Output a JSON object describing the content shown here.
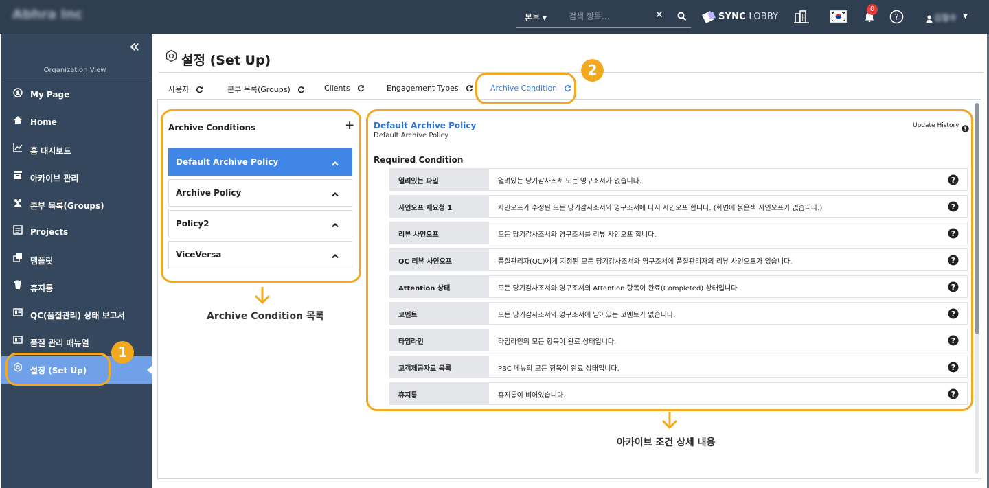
{
  "topbar": {
    "brand": "Abhra Inc",
    "scope_label": "본부 ▾",
    "search_placeholder": "검색 항목...",
    "clear_symbol": "✕",
    "sync_bold": "SYNC",
    "sync_light": "LOBBY",
    "notification_count": "0",
    "user_name": "김철수"
  },
  "sidebar": {
    "collapse_symbol": "«",
    "org_view_label": "Organization View",
    "items": [
      {
        "label": "My Page",
        "icon": "user-circle-icon"
      },
      {
        "label": "Home",
        "icon": "home-icon"
      },
      {
        "label": "홈 대시보드",
        "icon": "line-chart-icon"
      },
      {
        "label": "아카이브 관리",
        "icon": "archive-box-icon"
      },
      {
        "label": "본부 목록(Groups)",
        "icon": "users-icon"
      },
      {
        "label": "Projects",
        "icon": "projects-icon"
      },
      {
        "label": "템플릿",
        "icon": "template-icon"
      },
      {
        "label": "휴지통",
        "icon": "trash-icon"
      },
      {
        "label": "QC(품질관리) 상태 보고서",
        "icon": "report-icon"
      },
      {
        "label": "품질 관리 매뉴얼",
        "icon": "manual-icon"
      },
      {
        "label": "설정 (Set Up)",
        "icon": "settings-icon",
        "active": true
      }
    ]
  },
  "page": {
    "title": "설정 (Set Up)",
    "tabs": [
      {
        "label": "사용자"
      },
      {
        "label": "본부 목록(Groups)"
      },
      {
        "label": "Clients"
      },
      {
        "label": "Engagement Types"
      },
      {
        "label": "Archive Condition",
        "active": true
      }
    ]
  },
  "archive_list": {
    "title": "Archive Conditions",
    "add_symbol": "+",
    "policies": [
      {
        "label": "Default Archive Policy",
        "selected": true
      },
      {
        "label": "Archive Policy"
      },
      {
        "label": "Policy2"
      },
      {
        "label": "ViceVersa"
      }
    ]
  },
  "detail": {
    "title": "Default Archive Policy",
    "subtitle": "Default Archive Policy",
    "update_history": "Update History",
    "required_title": "Required Condition",
    "conditions": [
      {
        "name": "열려있는 파일",
        "desc": "열려있는 당기감사조서 또는 영구조서가 없습니다."
      },
      {
        "name": "사인오프 재요청 1",
        "desc": "사인오프가 수정된 모든 당기감사조서와 영구조서에 다시 사인오프 합니다. (화면에 붉은색 사인오프가 없습니다.)"
      },
      {
        "name": "리뷰 사인오프",
        "desc": "모든 당기감사조서와 영구조서를 리뷰 사인오프 합니다."
      },
      {
        "name": "QC 리뷰 사인오프",
        "desc": "품질관리자(QC)에게 지정된 모든 당기감사조서와 영구조서에 품질관리자의 리뷰 사인오프가 있습니다."
      },
      {
        "name": "Attention 상태",
        "desc": "모든 당기감사조서와 영구조서의 Attention 항목이 완료(Completed) 상태입니다."
      },
      {
        "name": "코멘트",
        "desc": "모든 당기감사조서와 영구조서에 남아있는 코멘트가 없습니다."
      },
      {
        "name": "타임라인",
        "desc": "타임라인의 모든 항목이 완료 상태입니다."
      },
      {
        "name": "고객제공자료 목록",
        "desc": "PBC 메뉴의 모든 항목이 완료 상태입니다."
      },
      {
        "name": "휴지통",
        "desc": "휴지통이 비어있습니다."
      }
    ]
  },
  "annotations": {
    "badge_1": "1",
    "badge_2": "2",
    "list_label": "Archive Condition 목록",
    "detail_label": "아카이브 조건 상세 내용",
    "highlight_color": "#f2a91f"
  },
  "colors": {
    "topbar": "#2f3e51",
    "sidebar": "#34475c",
    "sidebar_active": "#6fa0e8",
    "selected_policy": "#3f86e6",
    "link_blue": "#2f74d3"
  }
}
